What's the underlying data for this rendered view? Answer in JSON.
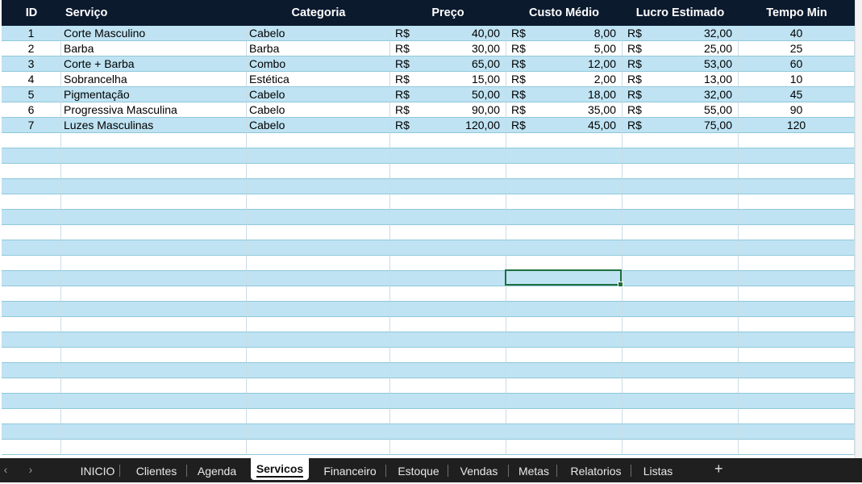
{
  "table": {
    "headers": [
      "ID",
      "Serviço",
      "Categoria",
      "Preço",
      "Custo Médio",
      "Lucro Estimado",
      "Tempo Min"
    ],
    "currency": "R$",
    "rows": [
      {
        "id": "1",
        "servico": "Corte Masculino",
        "categoria": "Cabelo",
        "preco": "40,00",
        "custo": "8,00",
        "lucro": "32,00",
        "tempo": "40"
      },
      {
        "id": "2",
        "servico": "Barba",
        "categoria": "Barba",
        "preco": "30,00",
        "custo": "5,00",
        "lucro": "25,00",
        "tempo": "25"
      },
      {
        "id": "3",
        "servico": "Corte + Barba",
        "categoria": "Combo",
        "preco": "65,00",
        "custo": "12,00",
        "lucro": "53,00",
        "tempo": "60"
      },
      {
        "id": "4",
        "servico": "Sobrancelha",
        "categoria": "Estética",
        "preco": "15,00",
        "custo": "2,00",
        "lucro": "13,00",
        "tempo": "10"
      },
      {
        "id": "5",
        "servico": "Pigmentação",
        "categoria": "Cabelo",
        "preco": "50,00",
        "custo": "18,00",
        "lucro": "32,00",
        "tempo": "45"
      },
      {
        "id": "6",
        "servico": "Progressiva Masculina",
        "categoria": "Cabelo",
        "preco": "90,00",
        "custo": "35,00",
        "lucro": "55,00",
        "tempo": "90"
      },
      {
        "id": "7",
        "servico": "Luzes Masculinas",
        "categoria": "Cabelo",
        "preco": "120,00",
        "custo": "45,00",
        "lucro": "75,00",
        "tempo": "120"
      }
    ]
  },
  "sheet_tabs": {
    "prev_icon": "‹",
    "next_icon": "›",
    "add_icon": "+",
    "active": "Servicos",
    "tabs": [
      "INICIO",
      "Clientes",
      "Agenda",
      "Servicos",
      "Financeiro",
      "Estoque",
      "Vendas",
      "Metas",
      "Relatorios",
      "Listas"
    ]
  },
  "colors": {
    "header_bg": "#0c1a2e",
    "band_bg": "#bfe3f3",
    "selection": "#1f6f3f",
    "tabbar_bg": "#1f1f1f"
  }
}
